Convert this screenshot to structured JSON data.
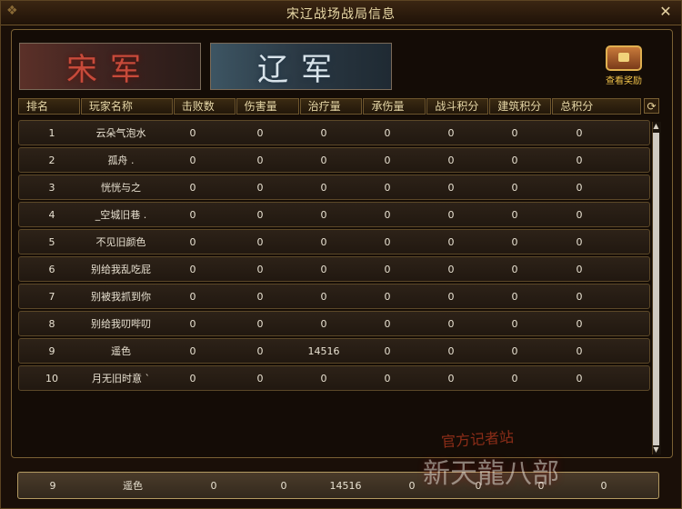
{
  "window": {
    "title": "宋辽战场战局信息",
    "close_icon": "✕"
  },
  "factions": {
    "song_label": "宋军",
    "liao_label": "辽军"
  },
  "reward": {
    "label": "查看奖励"
  },
  "columns": [
    "排名",
    "玩家名称",
    "击败数",
    "伤害量",
    "治疗量",
    "承伤量",
    "战斗积分",
    "建筑积分",
    "总积分"
  ],
  "rows": [
    {
      "rank": "1",
      "name": "云朵气泡水",
      "kills": "0",
      "damage": "0",
      "heal": "0",
      "taken": "0",
      "battle": "0",
      "building": "0",
      "total": "0"
    },
    {
      "rank": "2",
      "name": "孤舟 .",
      "kills": "0",
      "damage": "0",
      "heal": "0",
      "taken": "0",
      "battle": "0",
      "building": "0",
      "total": "0"
    },
    {
      "rank": "3",
      "name": "恍恍与之",
      "kills": "0",
      "damage": "0",
      "heal": "0",
      "taken": "0",
      "battle": "0",
      "building": "0",
      "total": "0"
    },
    {
      "rank": "4",
      "name": "_空城旧巷 .",
      "kills": "0",
      "damage": "0",
      "heal": "0",
      "taken": "0",
      "battle": "0",
      "building": "0",
      "total": "0"
    },
    {
      "rank": "5",
      "name": "不见旧颜色",
      "kills": "0",
      "damage": "0",
      "heal": "0",
      "taken": "0",
      "battle": "0",
      "building": "0",
      "total": "0"
    },
    {
      "rank": "6",
      "name": "别给我乱吃屁",
      "kills": "0",
      "damage": "0",
      "heal": "0",
      "taken": "0",
      "battle": "0",
      "building": "0",
      "total": "0"
    },
    {
      "rank": "7",
      "name": "别被我抓到你",
      "kills": "0",
      "damage": "0",
      "heal": "0",
      "taken": "0",
      "battle": "0",
      "building": "0",
      "total": "0"
    },
    {
      "rank": "8",
      "name": "别给我叨哔叨",
      "kills": "0",
      "damage": "0",
      "heal": "0",
      "taken": "0",
      "battle": "0",
      "building": "0",
      "total": "0"
    },
    {
      "rank": "9",
      "name": "遥色",
      "kills": "0",
      "damage": "0",
      "heal": "14516",
      "taken": "0",
      "battle": "0",
      "building": "0",
      "total": "0"
    },
    {
      "rank": "10",
      "name": "月无旧时意 `",
      "kills": "0",
      "damage": "0",
      "heal": "0",
      "taken": "0",
      "battle": "0",
      "building": "0",
      "total": "0"
    }
  ],
  "my_row": {
    "rank": "9",
    "name": "遥色",
    "kills": "0",
    "damage": "0",
    "heal": "14516",
    "taken": "0",
    "battle": "0",
    "building": "0",
    "total": "0"
  },
  "watermark": {
    "line1": "官方记者站",
    "line2": "新天龍八部"
  },
  "colors": {
    "gold": "#e5d6a6",
    "frame": "#7a6034",
    "song_red": "#c74a3a",
    "liao_blue": "#3d5563"
  }
}
